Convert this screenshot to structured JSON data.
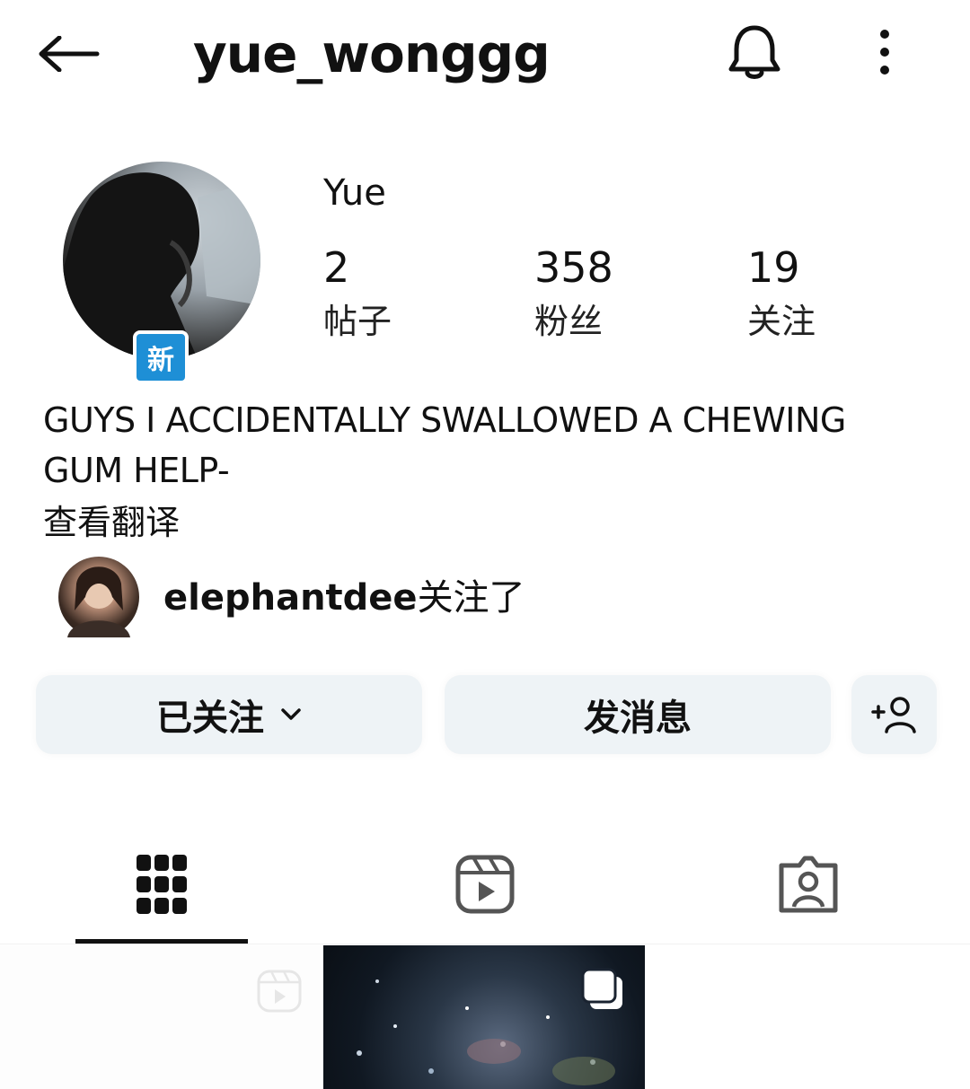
{
  "header": {
    "username": "yue_wonggg",
    "back_icon": "arrow-left-icon",
    "notification_icon": "bell-icon",
    "more_icon": "more-vertical-icon"
  },
  "profile": {
    "avatar_icon": "profile-avatar",
    "new_badge": "新",
    "display_name": "Yue",
    "stats": [
      {
        "value": "2",
        "label": "帖子"
      },
      {
        "value": "358",
        "label": "粉丝"
      },
      {
        "value": "19",
        "label": "关注"
      }
    ],
    "bio_line1": "GUYS I ACCIDENTALLY SWALLOWED A CHEWING",
    "bio_line2": "GUM HELP-",
    "see_translation": "查看翻译",
    "followed_by_user": "elephantdee",
    "followed_by_suffix": "关注了"
  },
  "actions": {
    "following_label": "已关注",
    "message_label": "发消息",
    "add_user_icon": "add-person-icon"
  },
  "tabs": [
    {
      "icon": "grid-icon",
      "active": true
    },
    {
      "icon": "reels-icon",
      "active": false
    },
    {
      "icon": "tagged-person-icon",
      "active": false
    }
  ],
  "colors": {
    "badge_blue": "#1e8fd6",
    "button_bg": "#eef3f6",
    "text": "#111111"
  }
}
